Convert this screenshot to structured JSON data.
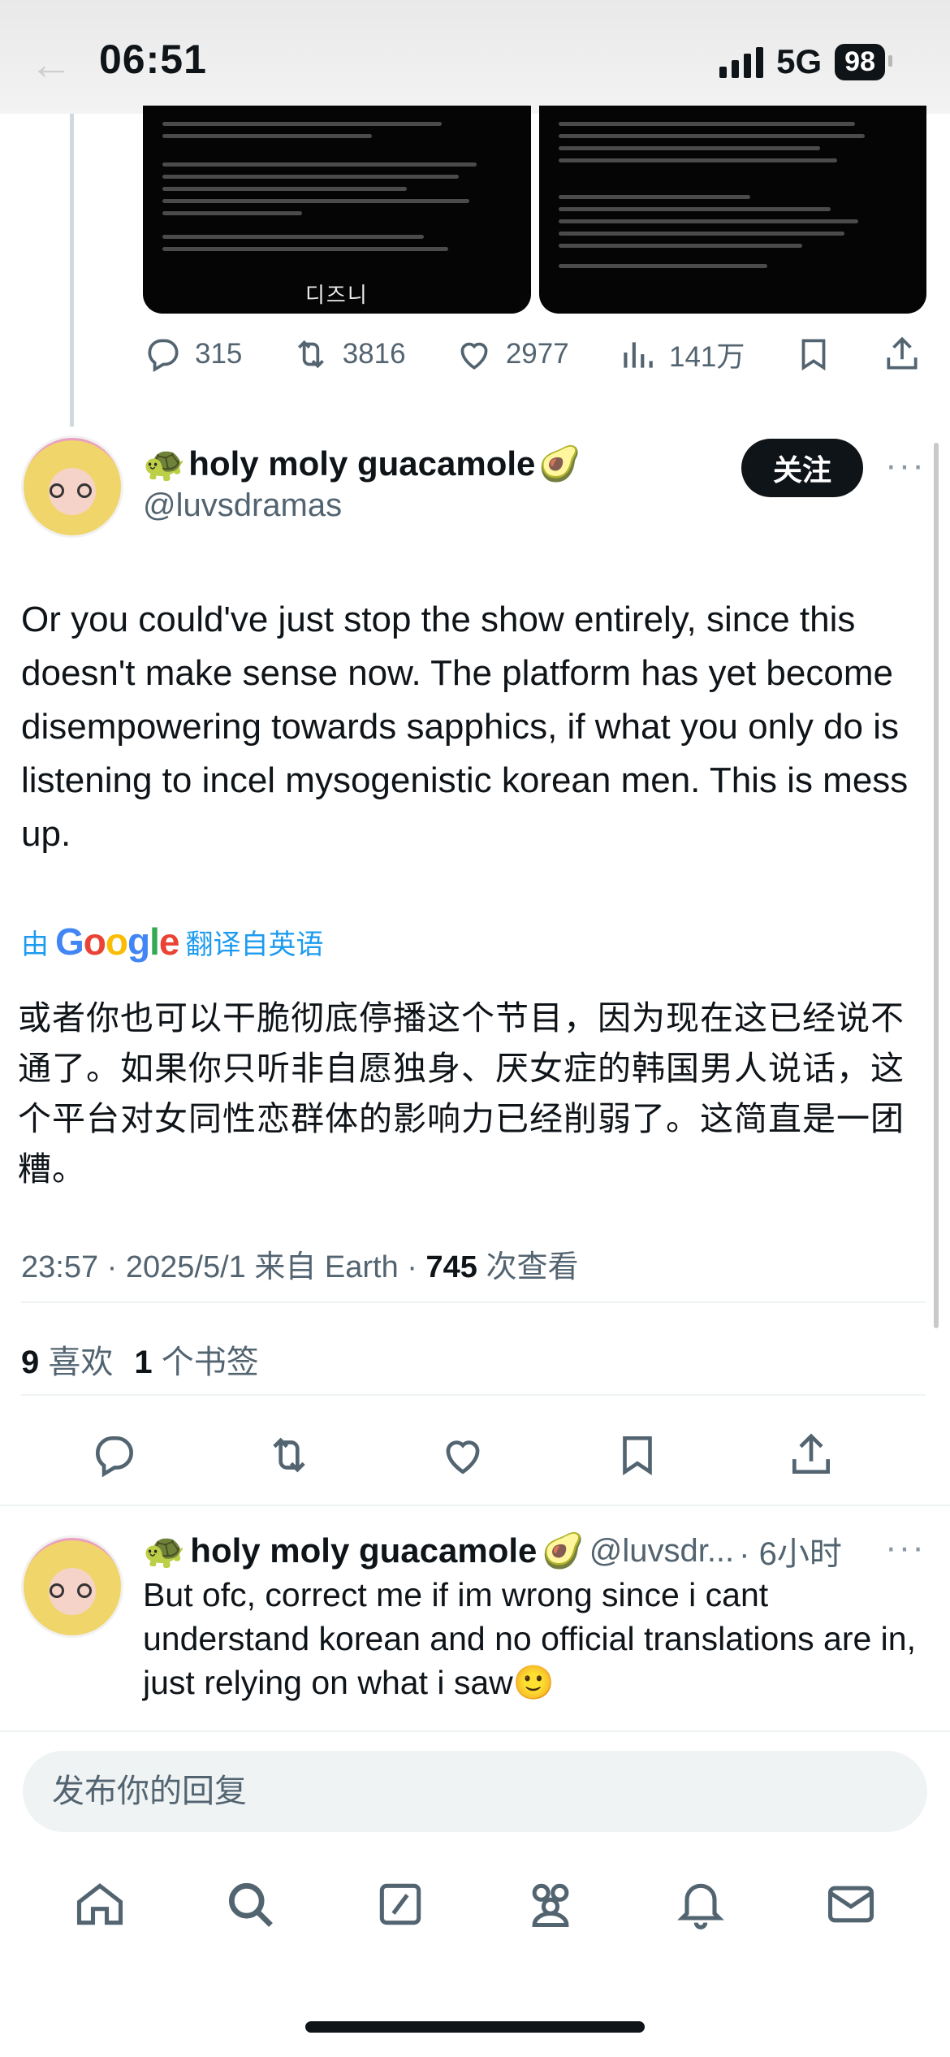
{
  "status_bar": {
    "time": "06:51",
    "network": "5G",
    "battery": "98"
  },
  "previous_tweet": {
    "media_logo_text": "디즈니",
    "actions": {
      "replies": "315",
      "reposts": "3816",
      "likes": "2977",
      "views": "141万"
    }
  },
  "main_tweet": {
    "display_name": "holy moly guacamole",
    "name_prefix_emoji": "🐢",
    "name_suffix_emoji": "🥑",
    "handle": "@luvsdramas",
    "follow_label": "关注",
    "more_label": "···",
    "text": "Or you could've just stop the show entirely, since this doesn't make sense now. The platform has yet become disempowering towards sapphics, if what you only do is listening to incel mysogenistic korean men. This is mess up.",
    "translate": {
      "prefix": "由",
      "brand": "Google",
      "suffix": "翻译自英语"
    },
    "translated_text": "或者你也可以干脆彻底停播这个节目，因为现在这已经说不通了。如果你只听非自愿独身、厌女症的韩国男人说话，这个平台对女同性恋群体的影响力已经削弱了。这简直是一团糟。",
    "meta": {
      "time": "23:57",
      "date": "2025/5/1",
      "source": "来自 Earth",
      "views": "745",
      "views_label": "次查看"
    },
    "stats": {
      "likes": "9",
      "likes_label": "喜欢",
      "bookmarks": "1",
      "bookmarks_label": "个书签"
    }
  },
  "reply": {
    "display_name": "holy moly guacamole",
    "name_prefix_emoji": "🐢",
    "name_suffix_emoji": "🥑",
    "handle": "@luvsdr...",
    "time": "· 6小时",
    "more_label": "···",
    "text": "But ofc, correct me if im wrong since i cant understand korean and no official translations are in, just relying on what i saw🙂"
  },
  "composer": {
    "placeholder": "发布你的回复"
  },
  "icons": {
    "reply": "reply-icon",
    "repost": "repost-icon",
    "like": "heart-icon",
    "views": "views-icon",
    "bookmark": "bookmark-icon",
    "share": "share-icon",
    "tabs": [
      "home-icon",
      "search-icon",
      "grok-icon",
      "communities-icon",
      "notifications-icon",
      "messages-icon"
    ]
  },
  "colors": {
    "accent": "#1d9bf0",
    "text": "#0f1419",
    "secondary": "#536471"
  }
}
